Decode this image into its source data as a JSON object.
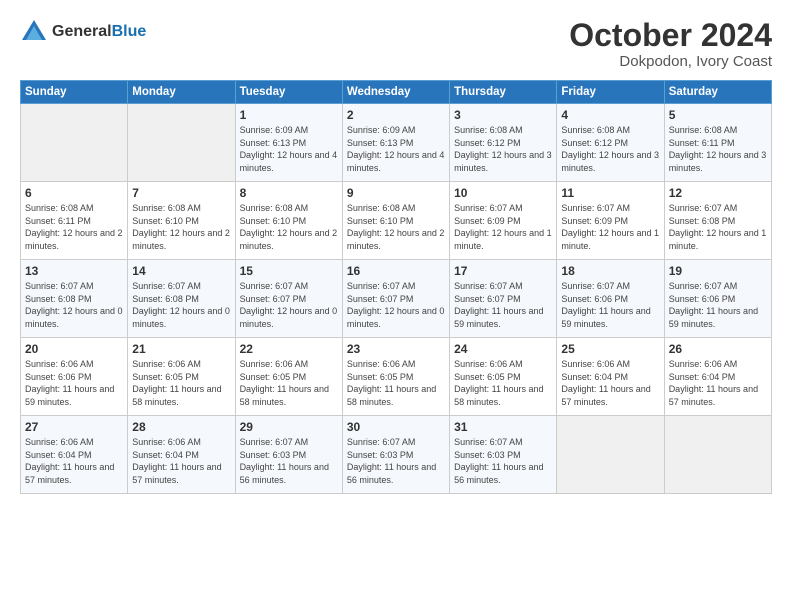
{
  "header": {
    "logo_general": "General",
    "logo_blue": "Blue",
    "title": "October 2024",
    "location": "Dokpodon, Ivory Coast"
  },
  "weekdays": [
    "Sunday",
    "Monday",
    "Tuesday",
    "Wednesday",
    "Thursday",
    "Friday",
    "Saturday"
  ],
  "weeks": [
    [
      {
        "day": "",
        "sunrise": "",
        "sunset": "",
        "daylight": ""
      },
      {
        "day": "",
        "sunrise": "",
        "sunset": "",
        "daylight": ""
      },
      {
        "day": "1",
        "sunrise": "Sunrise: 6:09 AM",
        "sunset": "Sunset: 6:13 PM",
        "daylight": "Daylight: 12 hours and 4 minutes."
      },
      {
        "day": "2",
        "sunrise": "Sunrise: 6:09 AM",
        "sunset": "Sunset: 6:13 PM",
        "daylight": "Daylight: 12 hours and 4 minutes."
      },
      {
        "day": "3",
        "sunrise": "Sunrise: 6:08 AM",
        "sunset": "Sunset: 6:12 PM",
        "daylight": "Daylight: 12 hours and 3 minutes."
      },
      {
        "day": "4",
        "sunrise": "Sunrise: 6:08 AM",
        "sunset": "Sunset: 6:12 PM",
        "daylight": "Daylight: 12 hours and 3 minutes."
      },
      {
        "day": "5",
        "sunrise": "Sunrise: 6:08 AM",
        "sunset": "Sunset: 6:11 PM",
        "daylight": "Daylight: 12 hours and 3 minutes."
      }
    ],
    [
      {
        "day": "6",
        "sunrise": "Sunrise: 6:08 AM",
        "sunset": "Sunset: 6:11 PM",
        "daylight": "Daylight: 12 hours and 2 minutes."
      },
      {
        "day": "7",
        "sunrise": "Sunrise: 6:08 AM",
        "sunset": "Sunset: 6:10 PM",
        "daylight": "Daylight: 12 hours and 2 minutes."
      },
      {
        "day": "8",
        "sunrise": "Sunrise: 6:08 AM",
        "sunset": "Sunset: 6:10 PM",
        "daylight": "Daylight: 12 hours and 2 minutes."
      },
      {
        "day": "9",
        "sunrise": "Sunrise: 6:08 AM",
        "sunset": "Sunset: 6:10 PM",
        "daylight": "Daylight: 12 hours and 2 minutes."
      },
      {
        "day": "10",
        "sunrise": "Sunrise: 6:07 AM",
        "sunset": "Sunset: 6:09 PM",
        "daylight": "Daylight: 12 hours and 1 minute."
      },
      {
        "day": "11",
        "sunrise": "Sunrise: 6:07 AM",
        "sunset": "Sunset: 6:09 PM",
        "daylight": "Daylight: 12 hours and 1 minute."
      },
      {
        "day": "12",
        "sunrise": "Sunrise: 6:07 AM",
        "sunset": "Sunset: 6:08 PM",
        "daylight": "Daylight: 12 hours and 1 minute."
      }
    ],
    [
      {
        "day": "13",
        "sunrise": "Sunrise: 6:07 AM",
        "sunset": "Sunset: 6:08 PM",
        "daylight": "Daylight: 12 hours and 0 minutes."
      },
      {
        "day": "14",
        "sunrise": "Sunrise: 6:07 AM",
        "sunset": "Sunset: 6:08 PM",
        "daylight": "Daylight: 12 hours and 0 minutes."
      },
      {
        "day": "15",
        "sunrise": "Sunrise: 6:07 AM",
        "sunset": "Sunset: 6:07 PM",
        "daylight": "Daylight: 12 hours and 0 minutes."
      },
      {
        "day": "16",
        "sunrise": "Sunrise: 6:07 AM",
        "sunset": "Sunset: 6:07 PM",
        "daylight": "Daylight: 12 hours and 0 minutes."
      },
      {
        "day": "17",
        "sunrise": "Sunrise: 6:07 AM",
        "sunset": "Sunset: 6:07 PM",
        "daylight": "Daylight: 11 hours and 59 minutes."
      },
      {
        "day": "18",
        "sunrise": "Sunrise: 6:07 AM",
        "sunset": "Sunset: 6:06 PM",
        "daylight": "Daylight: 11 hours and 59 minutes."
      },
      {
        "day": "19",
        "sunrise": "Sunrise: 6:07 AM",
        "sunset": "Sunset: 6:06 PM",
        "daylight": "Daylight: 11 hours and 59 minutes."
      }
    ],
    [
      {
        "day": "20",
        "sunrise": "Sunrise: 6:06 AM",
        "sunset": "Sunset: 6:06 PM",
        "daylight": "Daylight: 11 hours and 59 minutes."
      },
      {
        "day": "21",
        "sunrise": "Sunrise: 6:06 AM",
        "sunset": "Sunset: 6:05 PM",
        "daylight": "Daylight: 11 hours and 58 minutes."
      },
      {
        "day": "22",
        "sunrise": "Sunrise: 6:06 AM",
        "sunset": "Sunset: 6:05 PM",
        "daylight": "Daylight: 11 hours and 58 minutes."
      },
      {
        "day": "23",
        "sunrise": "Sunrise: 6:06 AM",
        "sunset": "Sunset: 6:05 PM",
        "daylight": "Daylight: 11 hours and 58 minutes."
      },
      {
        "day": "24",
        "sunrise": "Sunrise: 6:06 AM",
        "sunset": "Sunset: 6:05 PM",
        "daylight": "Daylight: 11 hours and 58 minutes."
      },
      {
        "day": "25",
        "sunrise": "Sunrise: 6:06 AM",
        "sunset": "Sunset: 6:04 PM",
        "daylight": "Daylight: 11 hours and 57 minutes."
      },
      {
        "day": "26",
        "sunrise": "Sunrise: 6:06 AM",
        "sunset": "Sunset: 6:04 PM",
        "daylight": "Daylight: 11 hours and 57 minutes."
      }
    ],
    [
      {
        "day": "27",
        "sunrise": "Sunrise: 6:06 AM",
        "sunset": "Sunset: 6:04 PM",
        "daylight": "Daylight: 11 hours and 57 minutes."
      },
      {
        "day": "28",
        "sunrise": "Sunrise: 6:06 AM",
        "sunset": "Sunset: 6:04 PM",
        "daylight": "Daylight: 11 hours and 57 minutes."
      },
      {
        "day": "29",
        "sunrise": "Sunrise: 6:07 AM",
        "sunset": "Sunset: 6:03 PM",
        "daylight": "Daylight: 11 hours and 56 minutes."
      },
      {
        "day": "30",
        "sunrise": "Sunrise: 6:07 AM",
        "sunset": "Sunset: 6:03 PM",
        "daylight": "Daylight: 11 hours and 56 minutes."
      },
      {
        "day": "31",
        "sunrise": "Sunrise: 6:07 AM",
        "sunset": "Sunset: 6:03 PM",
        "daylight": "Daylight: 11 hours and 56 minutes."
      },
      {
        "day": "",
        "sunrise": "",
        "sunset": "",
        "daylight": ""
      },
      {
        "day": "",
        "sunrise": "",
        "sunset": "",
        "daylight": ""
      }
    ]
  ]
}
